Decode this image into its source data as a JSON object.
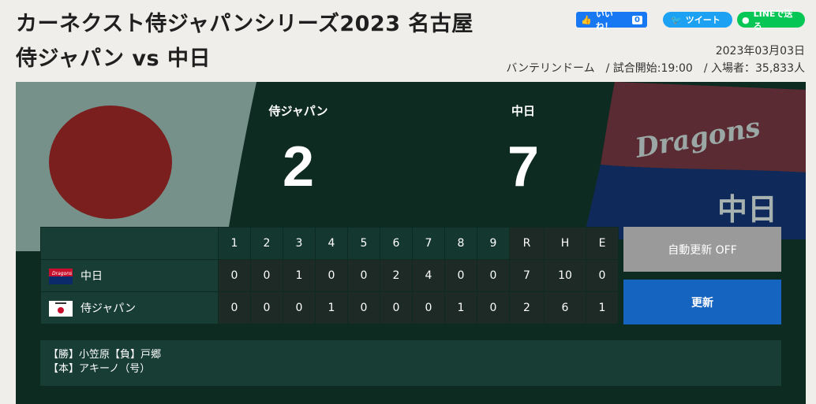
{
  "header": {
    "title_line1": "カーネクスト侍ジャパンシリーズ2023 名古屋",
    "title_line2": "侍ジャパン vs 中日",
    "date": "2023年03月03日",
    "info": "バンテリンドーム　/ 試合開始:19:00　/ 入場者：35,833人"
  },
  "social": {
    "facebook_label": "いいね！",
    "facebook_count": "0",
    "twitter_label": "ツイート",
    "line_label": "LINEで送る"
  },
  "scoreboard": {
    "home_team": "侍ジャパン",
    "away_team": "中日",
    "home_score": "2",
    "away_score": "7",
    "flag_right_text": "Dragons",
    "flag_right_banner": "中日"
  },
  "linescore": {
    "headers": [
      "1",
      "2",
      "3",
      "4",
      "5",
      "6",
      "7",
      "8",
      "9",
      "R",
      "H",
      "E"
    ],
    "rows": [
      {
        "team": "中日",
        "logo": "dragons-logo",
        "values": [
          "0",
          "0",
          "1",
          "0",
          "0",
          "2",
          "4",
          "0",
          "0",
          "7",
          "10",
          "0"
        ]
      },
      {
        "team": "侍ジャパン",
        "logo": "samurai-japan-logo",
        "values": [
          "0",
          "0",
          "0",
          "1",
          "0",
          "0",
          "0",
          "1",
          "0",
          "2",
          "6",
          "1"
        ]
      }
    ]
  },
  "buttons": {
    "auto_refresh": "自動更新 OFF",
    "refresh": "更新"
  },
  "result": {
    "line1": "【勝】小笠原【負】戸郷",
    "line2": "【本】アキーノ（号）"
  },
  "colors": {
    "board_bg": "#0e2b22",
    "refresh_button": "#1565c0",
    "auto_button": "#9a9a9a"
  }
}
